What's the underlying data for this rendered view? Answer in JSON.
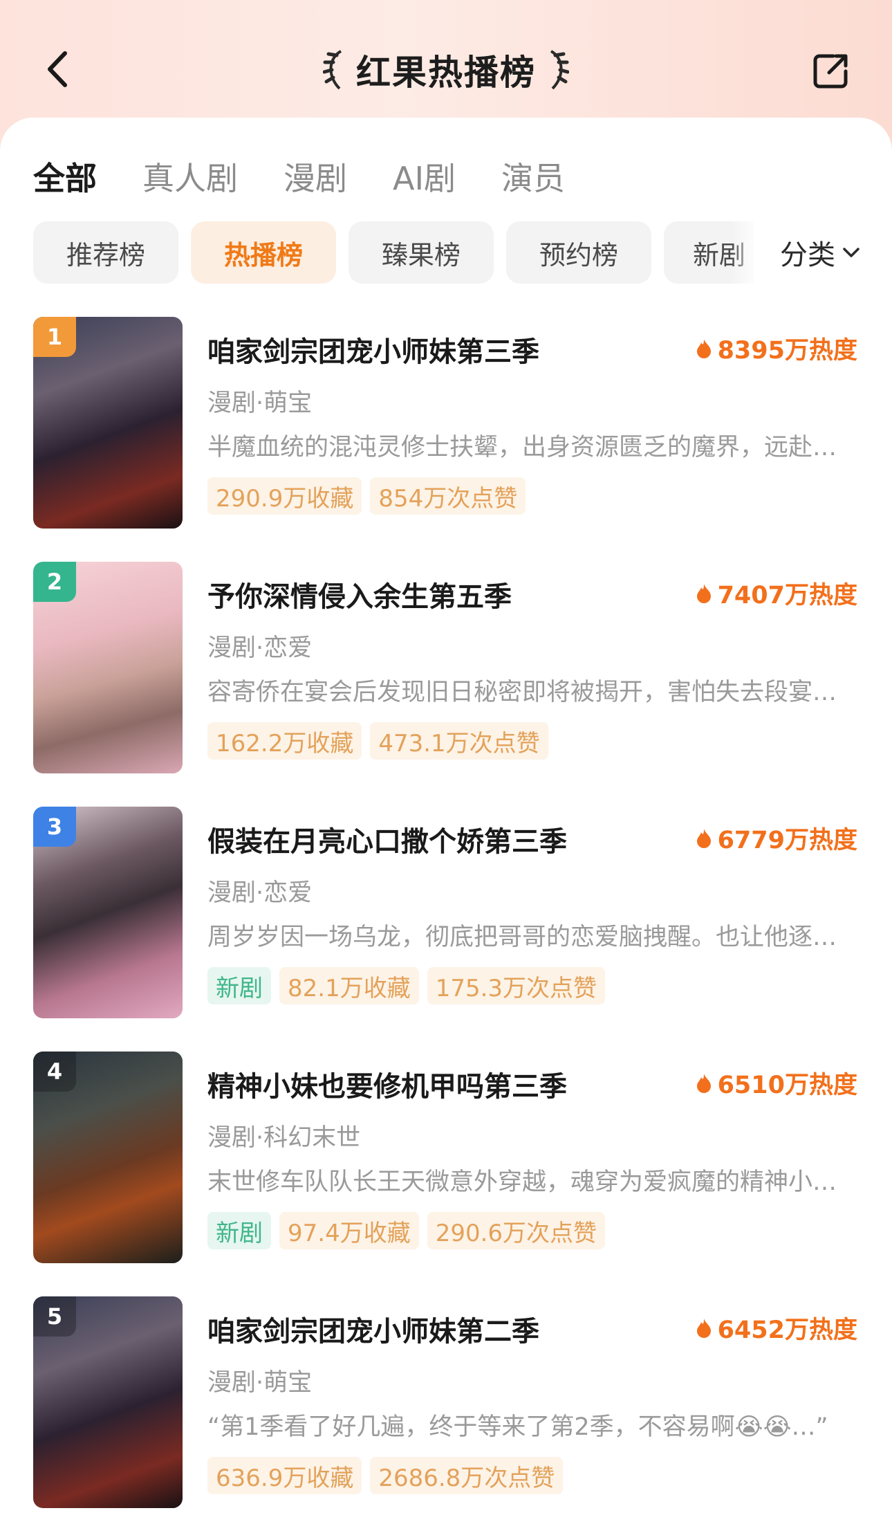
{
  "header": {
    "title": "红果热播榜",
    "back_icon": "chevron-left-icon",
    "share_icon": "share-icon",
    "laurel_icon": "laurel-icon"
  },
  "tabs": [
    {
      "label": "全部",
      "active": true
    },
    {
      "label": "真人剧",
      "active": false
    },
    {
      "label": "漫剧",
      "active": false
    },
    {
      "label": "AI剧",
      "active": false
    },
    {
      "label": "演员",
      "active": false
    }
  ],
  "chips": [
    {
      "label": "推荐榜",
      "active": false
    },
    {
      "label": "热播榜",
      "active": true
    },
    {
      "label": "臻果榜",
      "active": false
    },
    {
      "label": "预约榜",
      "active": false
    },
    {
      "label": "新剧",
      "active": false
    }
  ],
  "category": {
    "label": "分类",
    "icon": "chevron-down-icon"
  },
  "colors": {
    "accent": "#f07a17",
    "heat": "#f2701c",
    "rank1": "#f29a3a",
    "rank2": "#34b58e",
    "rank3": "#3e82e6",
    "new_tag": "#3fb68b"
  },
  "items": [
    {
      "rank": "1",
      "title": "咱家剑宗团宠小师妹第三季",
      "heat": "8395万热度",
      "genre": "漫剧·萌宝",
      "desc": "半魔血统的混沌灵修士扶颦，出身资源匮乏的魔界，远赴…",
      "tags": [
        "290.9万收藏",
        "854万次点赞"
      ],
      "is_new": false
    },
    {
      "rank": "2",
      "title": "予你深情侵入余生第五季",
      "heat": "7407万热度",
      "genre": "漫剧·恋爱",
      "desc": "容寄侨在宴会后发现旧日秘密即将被揭开，害怕失去段宴…",
      "tags": [
        "162.2万收藏",
        "473.1万次点赞"
      ],
      "is_new": false
    },
    {
      "rank": "3",
      "title": "假装在月亮心口撒个娇第三季",
      "heat": "6779万热度",
      "genre": "漫剧·恋爱",
      "desc": "周岁岁因一场乌龙，彻底把哥哥的恋爱脑拽醒。也让他逐…",
      "new_label": "新剧",
      "tags": [
        "82.1万收藏",
        "175.3万次点赞"
      ],
      "is_new": true
    },
    {
      "rank": "4",
      "title": "精神小妹也要修机甲吗第三季",
      "heat": "6510万热度",
      "genre": "漫剧·科幻末世",
      "desc": "末世修车队队长王天微意外穿越，魂穿为爱疯魔的精神小…",
      "new_label": "新剧",
      "tags": [
        "97.4万收藏",
        "290.6万次点赞"
      ],
      "is_new": true
    },
    {
      "rank": "5",
      "title": "咱家剑宗团宠小师妹第二季",
      "heat": "6452万热度",
      "genre": "漫剧·萌宝",
      "desc": "“第1季看了好几遍，终于等来了第2季，不容易啊😭😭…”",
      "tags": [
        "636.9万收藏",
        "2686.8万次点赞"
      ],
      "is_new": false
    }
  ]
}
